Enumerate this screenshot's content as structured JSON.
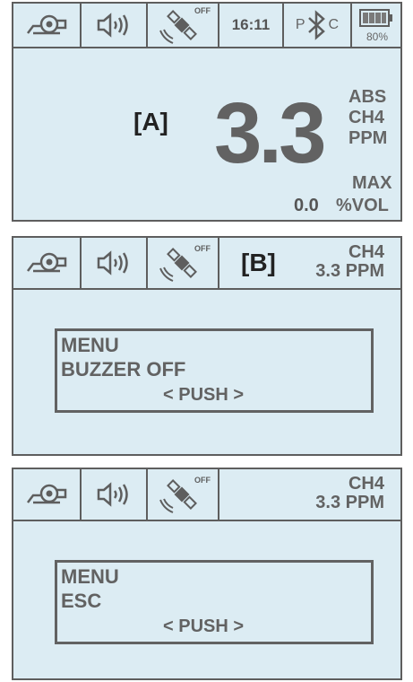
{
  "icons": {
    "pump": "pump-icon",
    "speaker": "speaker-icon",
    "gps_off": "gps-off-icon",
    "bluetooth": "bluetooth-icon",
    "battery": "battery-icon"
  },
  "colors": {
    "screen_bg": "#dcecf3",
    "border": "#5e5e5e",
    "text": "#626262",
    "label": "#222222"
  },
  "screen_a": {
    "status": {
      "gps_off_label": "OFF",
      "time": "16:11",
      "bt_left": "P",
      "bt_right": "C",
      "battery": "80%"
    },
    "tag": "[A]",
    "value": "3.3",
    "units": [
      "ABS",
      "CH4",
      "PPM"
    ],
    "max_label": "MAX",
    "max_value": "0.0",
    "max_unit": "%VOL"
  },
  "screen_b": {
    "status": {
      "gps_off_label": "OFF"
    },
    "tag": "[B]",
    "gas": "CH4",
    "reading_value": "3.3",
    "reading_unit": "PPM",
    "menu": {
      "title": "MENU",
      "item": "BUZZER OFF",
      "push": "< PUSH >"
    }
  },
  "screen_c": {
    "status": {
      "gps_off_label": "OFF"
    },
    "gas": "CH4",
    "reading_value": "3.3",
    "reading_unit": "PPM",
    "menu": {
      "title": "MENU",
      "item": "ESC",
      "push": "< PUSH >"
    }
  }
}
